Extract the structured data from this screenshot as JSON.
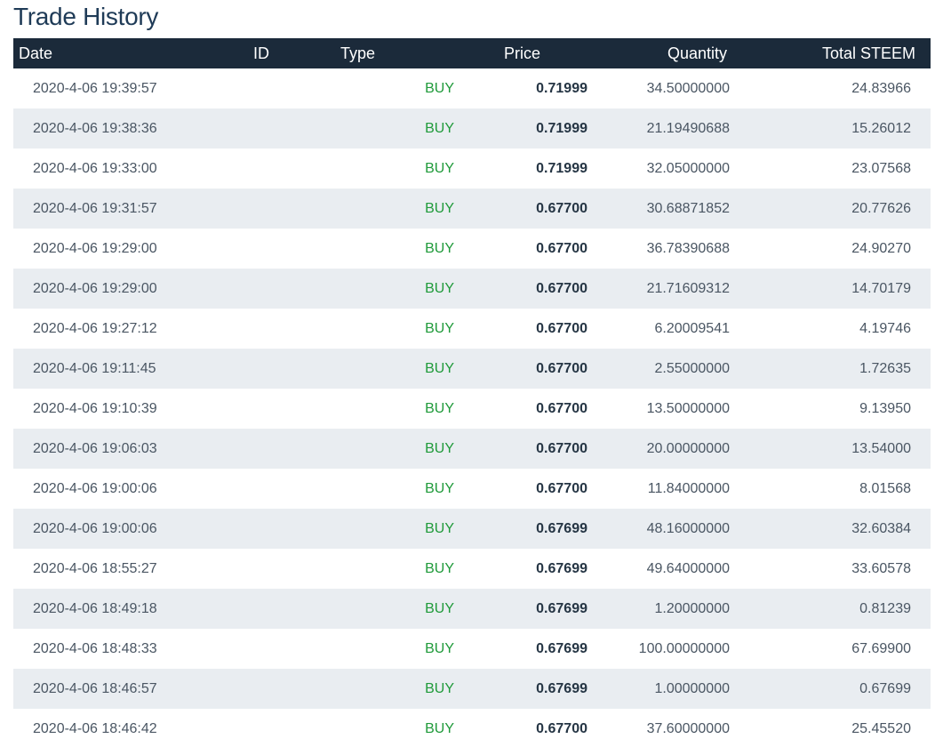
{
  "page_title": "Trade History",
  "columns": {
    "date": "Date",
    "id": "ID",
    "type": "Type",
    "price": "Price",
    "quantity": "Quantity",
    "total": "Total STEEM"
  },
  "rows": [
    {
      "date": "2020-4-06 19:39:57",
      "type": "BUY",
      "price": "0.71999",
      "quantity": "34.50000000",
      "total": "24.83966"
    },
    {
      "date": "2020-4-06 19:38:36",
      "type": "BUY",
      "price": "0.71999",
      "quantity": "21.19490688",
      "total": "15.26012"
    },
    {
      "date": "2020-4-06 19:33:00",
      "type": "BUY",
      "price": "0.71999",
      "quantity": "32.05000000",
      "total": "23.07568"
    },
    {
      "date": "2020-4-06 19:31:57",
      "type": "BUY",
      "price": "0.67700",
      "quantity": "30.68871852",
      "total": "20.77626"
    },
    {
      "date": "2020-4-06 19:29:00",
      "type": "BUY",
      "price": "0.67700",
      "quantity": "36.78390688",
      "total": "24.90270"
    },
    {
      "date": "2020-4-06 19:29:00",
      "type": "BUY",
      "price": "0.67700",
      "quantity": "21.71609312",
      "total": "14.70179"
    },
    {
      "date": "2020-4-06 19:27:12",
      "type": "BUY",
      "price": "0.67700",
      "quantity": "6.20009541",
      "total": "4.19746"
    },
    {
      "date": "2020-4-06 19:11:45",
      "type": "BUY",
      "price": "0.67700",
      "quantity": "2.55000000",
      "total": "1.72635"
    },
    {
      "date": "2020-4-06 19:10:39",
      "type": "BUY",
      "price": "0.67700",
      "quantity": "13.50000000",
      "total": "9.13950"
    },
    {
      "date": "2020-4-06 19:06:03",
      "type": "BUY",
      "price": "0.67700",
      "quantity": "20.00000000",
      "total": "13.54000"
    },
    {
      "date": "2020-4-06 19:00:06",
      "type": "BUY",
      "price": "0.67700",
      "quantity": "11.84000000",
      "total": "8.01568"
    },
    {
      "date": "2020-4-06 19:00:06",
      "type": "BUY",
      "price": "0.67699",
      "quantity": "48.16000000",
      "total": "32.60384"
    },
    {
      "date": "2020-4-06 18:55:27",
      "type": "BUY",
      "price": "0.67699",
      "quantity": "49.64000000",
      "total": "33.60578"
    },
    {
      "date": "2020-4-06 18:49:18",
      "type": "BUY",
      "price": "0.67699",
      "quantity": "1.20000000",
      "total": "0.81239"
    },
    {
      "date": "2020-4-06 18:48:33",
      "type": "BUY",
      "price": "0.67699",
      "quantity": "100.00000000",
      "total": "67.69900"
    },
    {
      "date": "2020-4-06 18:46:57",
      "type": "BUY",
      "price": "0.67699",
      "quantity": "1.00000000",
      "total": "0.67699"
    },
    {
      "date": "2020-4-06 18:46:42",
      "type": "BUY",
      "price": "0.67700",
      "quantity": "37.60000000",
      "total": "25.45520"
    }
  ],
  "colors": {
    "header_bg": "#1b2a3a",
    "title": "#1f3b57",
    "buy": "#1f9a3a",
    "stripe": "#e9edf1"
  }
}
